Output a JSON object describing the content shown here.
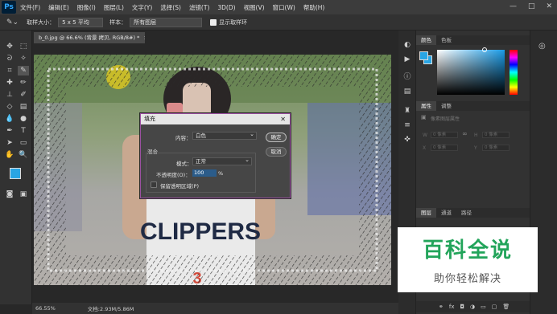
{
  "app": {
    "logo": "Ps",
    "window_controls": [
      "—",
      "□",
      "✕"
    ]
  },
  "menu": [
    "文件(F)",
    "编辑(E)",
    "图像(I)",
    "图层(L)",
    "文字(Y)",
    "选择(S)",
    "滤镜(T)",
    "3D(D)",
    "视图(V)",
    "窗口(W)",
    "帮助(H)"
  ],
  "options": {
    "sample_size_label": "取样大小：",
    "sample_size_value": "5 x 5 平均",
    "sample_label": "样本：",
    "sample_value": "所有图层",
    "show_ring": "显示取样环"
  },
  "document": {
    "tab_title": "b_0.jpg @ 66.6% (背景 拷贝, RGB/8#) *",
    "tab_close": "×",
    "zoom": "66.55%",
    "doc_size": "文档:2.93M/5.86M",
    "jersey_text": "CLIPPERS"
  },
  "dialog": {
    "title": "填充",
    "close": "✕",
    "content_label": "内容：",
    "content_value": "白色",
    "blend_group": "混合",
    "mode_label": "模式：",
    "mode_value": "正常",
    "opacity_label": "不透明度(O)：",
    "opacity_value": "100",
    "opacity_unit": "%",
    "preserve_label": "保留透明区域(P)",
    "ok": "确定",
    "cancel": "取消"
  },
  "panels": {
    "color_tabs": [
      "颜色",
      "色板"
    ],
    "props_tabs": [
      "属性",
      "调整"
    ],
    "props_title": "像素图层属性",
    "props_fields": [
      "W",
      "H",
      "X",
      "Y"
    ],
    "props_field_placeholder": "0 像素",
    "layers_tabs": [
      "图层",
      "通道",
      "路径"
    ],
    "footer_icons": [
      "⚭",
      "fx",
      "◘",
      "◑",
      "▭",
      "▢",
      "🗑"
    ]
  },
  "watermark": {
    "title": "百科全说",
    "subtitle": "助你轻松解决"
  },
  "colors": {
    "foreground": "#29a5e4",
    "dialog_border": "#9a4fa0",
    "watermark_green": "#22a45a"
  }
}
